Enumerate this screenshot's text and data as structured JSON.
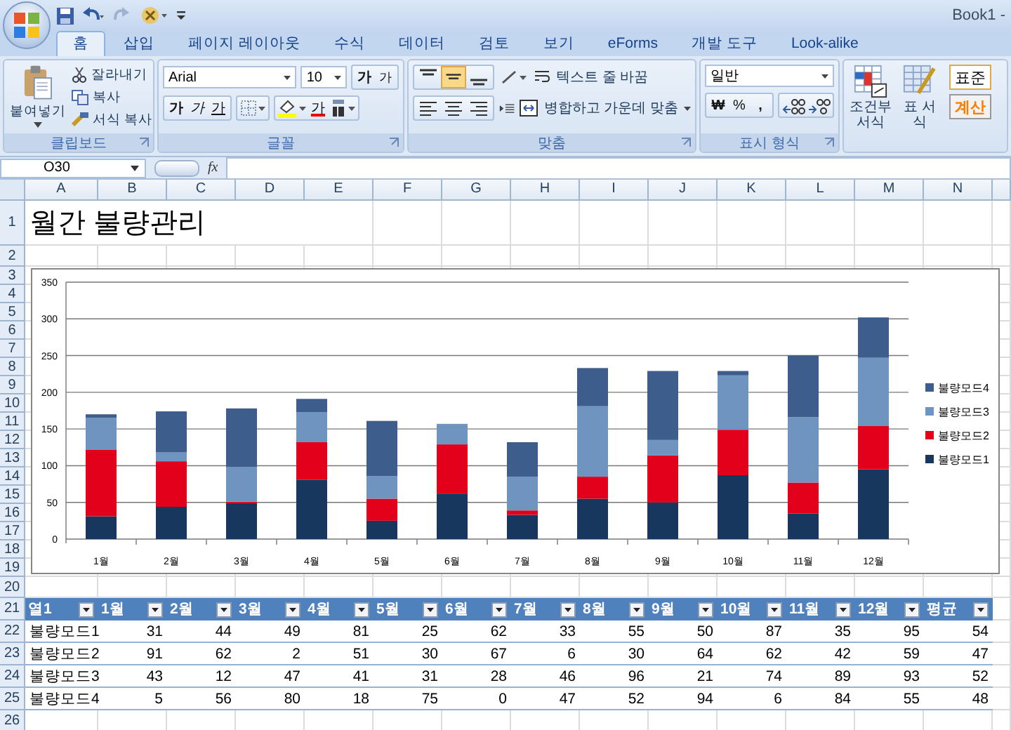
{
  "window": {
    "title": "Book1 -"
  },
  "tabs": [
    {
      "label": "홈",
      "selected": true
    },
    {
      "label": "삽입",
      "selected": false
    },
    {
      "label": "페이지 레이아웃",
      "selected": false
    },
    {
      "label": "수식",
      "selected": false
    },
    {
      "label": "데이터",
      "selected": false
    },
    {
      "label": "검토",
      "selected": false
    },
    {
      "label": "보기",
      "selected": false
    },
    {
      "label": "eForms",
      "selected": false
    },
    {
      "label": "개발 도구",
      "selected": false
    },
    {
      "label": "Look-alike",
      "selected": false
    }
  ],
  "clipboard": {
    "label": "클립보드",
    "paste": "붙여넣기",
    "cut": "잘라내기",
    "copy": "복사",
    "format_painter": "서식 복사"
  },
  "font": {
    "label": "글꼴",
    "font_name": "Arial",
    "font_size": "10",
    "grow": "가",
    "shrink": "가",
    "bold": "가",
    "italic": "가",
    "underline": "가",
    "font_color": "가"
  },
  "alignment": {
    "label": "맞춤",
    "vertical": [
      {
        "selected": false
      },
      {
        "selected": true
      },
      {
        "selected": false
      }
    ],
    "wrap_text": "텍스트 줄 바꿈",
    "merge_center": "병합하고 가운데 맞춤"
  },
  "number": {
    "label": "표시 형식",
    "format": "일반",
    "currency": "₩",
    "percent": "%",
    "comma": ","
  },
  "styles": {
    "conditional_formatting": "조건부 서식",
    "format_as_table": "표 서식",
    "cell_styles": [
      {
        "label": "표준",
        "kind": "normal"
      },
      {
        "label": "계산",
        "kind": "calculation"
      }
    ]
  },
  "formula_bar": {
    "name_box": "O30",
    "function_label": "fx"
  },
  "sheet": {
    "columns": [
      "A",
      "B",
      "C",
      "D",
      "E",
      "F",
      "G",
      "H",
      "I",
      "J",
      "K",
      "L",
      "M",
      "N"
    ],
    "title": "월간 불량관리",
    "rows": [
      {
        "number": "1",
        "kind": "title"
      },
      {
        "number": "2",
        "kind": "empty"
      },
      {
        "number": "3",
        "kind": "chart"
      },
      {
        "number": "4",
        "kind": "chart"
      },
      {
        "number": "5",
        "kind": "chart"
      },
      {
        "number": "6",
        "kind": "chart"
      },
      {
        "number": "7",
        "kind": "chart"
      },
      {
        "number": "8",
        "kind": "chart"
      },
      {
        "number": "9",
        "kind": "chart"
      },
      {
        "number": "10",
        "kind": "chart"
      },
      {
        "number": "11",
        "kind": "chart"
      },
      {
        "number": "12",
        "kind": "chart"
      },
      {
        "number": "13",
        "kind": "chart"
      },
      {
        "number": "14",
        "kind": "chart"
      },
      {
        "number": "15",
        "kind": "chart"
      },
      {
        "number": "16",
        "kind": "chart"
      },
      {
        "number": "17",
        "kind": "chart"
      },
      {
        "number": "18",
        "kind": "chart"
      },
      {
        "number": "19",
        "kind": "chart"
      },
      {
        "number": "20",
        "kind": "empty"
      },
      {
        "number": "21",
        "kind": "table_header"
      },
      {
        "number": "22",
        "kind": "table_row"
      },
      {
        "number": "23",
        "kind": "table_row"
      },
      {
        "number": "24",
        "kind": "table_row"
      },
      {
        "number": "25",
        "kind": "table_row"
      },
      {
        "number": "26",
        "kind": "empty"
      }
    ],
    "chart_data": {
      "type": "bar",
      "stacked": true,
      "grid": true,
      "legend": true,
      "categories": [
        "1월",
        "2월",
        "3월",
        "4월",
        "5월",
        "6월",
        "7월",
        "8월",
        "9월",
        "10월",
        "11월",
        "12월"
      ],
      "ylim": [
        0,
        350
      ],
      "yticks": [
        0,
        50,
        100,
        150,
        200,
        250,
        300,
        350
      ],
      "series": [
        {
          "name": "불량모드1",
          "color": "#17375e",
          "values": [
            31,
            44,
            49,
            81,
            25,
            62,
            33,
            55,
            50,
            87,
            35,
            95
          ]
        },
        {
          "name": "불량모드2",
          "color": "#e3001b",
          "values": [
            91,
            62,
            2,
            51,
            30,
            67,
            6,
            30,
            64,
            62,
            42,
            59
          ]
        },
        {
          "name": "불량모드3",
          "color": "#7094c0",
          "values": [
            43,
            12,
            47,
            41,
            31,
            28,
            46,
            96,
            21,
            74,
            89,
            93
          ]
        },
        {
          "name": "불량모드4",
          "color": "#3d5e8c",
          "values": [
            5,
            56,
            80,
            18,
            75,
            0,
            47,
            52,
            94,
            6,
            84,
            55
          ]
        }
      ]
    },
    "table": {
      "columns": [
        "열1",
        "1월",
        "2월",
        "3월",
        "4월",
        "5월",
        "6월",
        "7월",
        "8월",
        "9월",
        "10월",
        "11월",
        "12월",
        "평균"
      ],
      "rows": [
        {
          "label": "불량모드1",
          "values": [
            "31",
            "44",
            "49",
            "81",
            "25",
            "62",
            "33",
            "55",
            "50",
            "87",
            "35",
            "95",
            "54"
          ]
        },
        {
          "label": "불량모드2",
          "values": [
            "91",
            "62",
            "2",
            "51",
            "30",
            "67",
            "6",
            "30",
            "64",
            "62",
            "42",
            "59",
            "47"
          ]
        },
        {
          "label": "불량모드3",
          "values": [
            "43",
            "12",
            "47",
            "41",
            "31",
            "28",
            "46",
            "96",
            "21",
            "74",
            "89",
            "93",
            "52"
          ]
        },
        {
          "label": "불량모드4",
          "values": [
            "5",
            "56",
            "80",
            "18",
            "75",
            "0",
            "47",
            "52",
            "94",
            "6",
            "84",
            "55",
            "48"
          ]
        }
      ]
    }
  }
}
